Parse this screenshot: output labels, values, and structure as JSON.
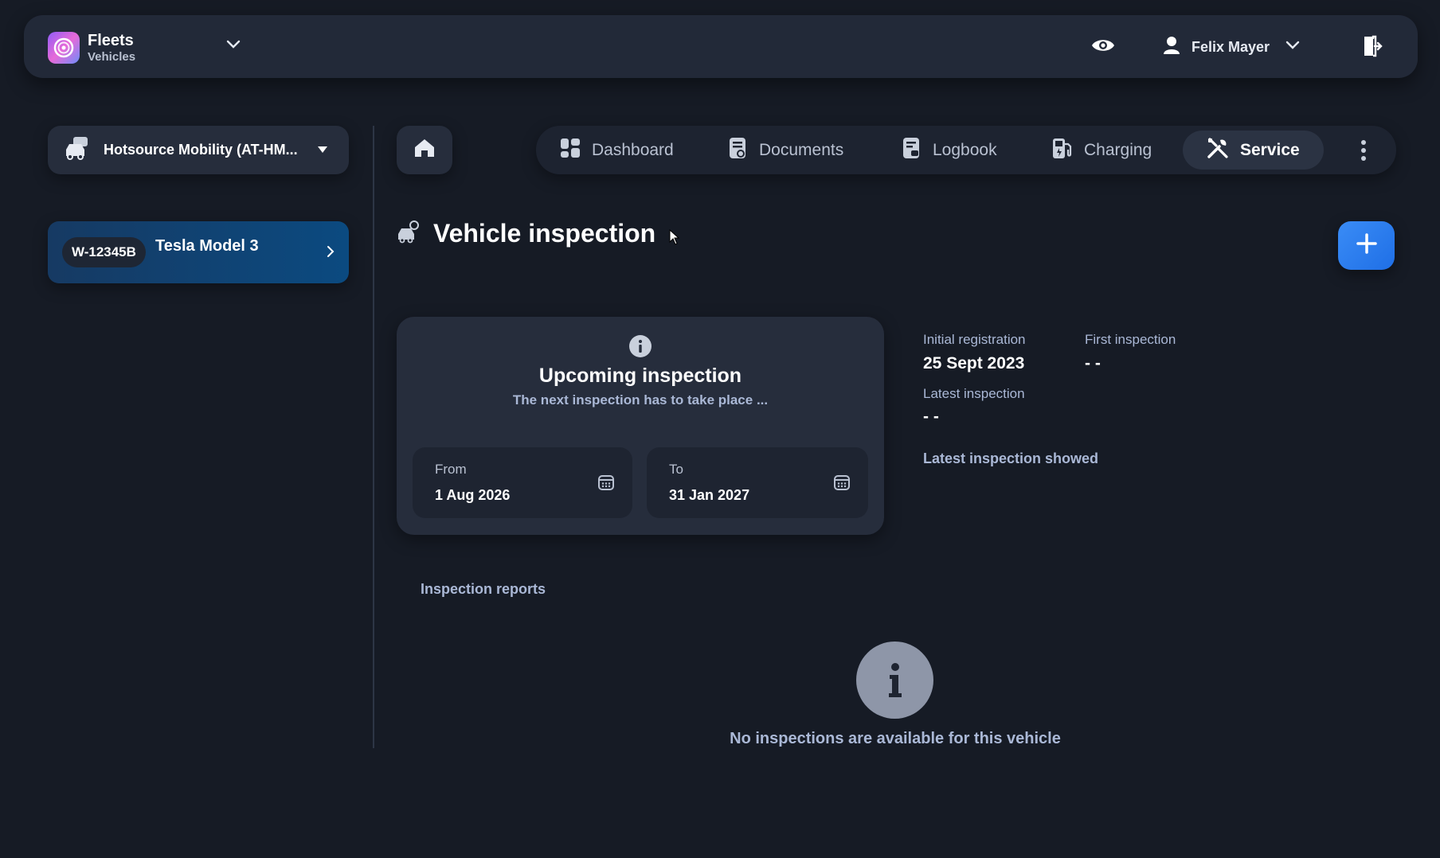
{
  "brand": {
    "title": "Fleets",
    "subtitle": "Vehicles",
    "logo_icon": "swirl-logo",
    "accent_gradient": [
      "#8f5cf6",
      "#e76ad8",
      "#6e8dfa"
    ]
  },
  "header": {
    "user_name": "Felix Mayer"
  },
  "sidebar": {
    "organization": "Hotsource Mobility (AT-HM...",
    "vehicle": {
      "plate": "W-12345B",
      "model": "Tesla Model 3",
      "card_color": "#0b4a80"
    }
  },
  "nav": {
    "tabs": [
      {
        "label": "Dashboard",
        "icon": "grid-icon",
        "active": false
      },
      {
        "label": "Documents",
        "icon": "document-icon",
        "active": false
      },
      {
        "label": "Logbook",
        "icon": "logbook-icon",
        "active": false
      },
      {
        "label": "Charging",
        "icon": "fuel-pump-icon",
        "active": false
      },
      {
        "label": "Service",
        "icon": "tools-icon",
        "active": true
      }
    ]
  },
  "main": {
    "title": "Vehicle inspection",
    "upcoming": {
      "title": "Upcoming inspection",
      "subtitle": "The next inspection has to take place ...",
      "from_label": "From",
      "from_value": "1 Aug 2026",
      "to_label": "To",
      "to_value": "31 Jan 2027"
    },
    "info": {
      "initial_registration_label": "Initial registration",
      "initial_registration_value": "25 Sept 2023",
      "first_inspection_label": "First inspection",
      "first_inspection_value": "- -",
      "latest_inspection_label": "Latest inspection",
      "latest_inspection_value": "- -",
      "latest_inspection_link": "Latest inspection showed"
    },
    "reports": {
      "label": "Inspection reports",
      "empty_text": "No inspections are available for this vehicle"
    },
    "add_button_color": "#2f80ed"
  }
}
